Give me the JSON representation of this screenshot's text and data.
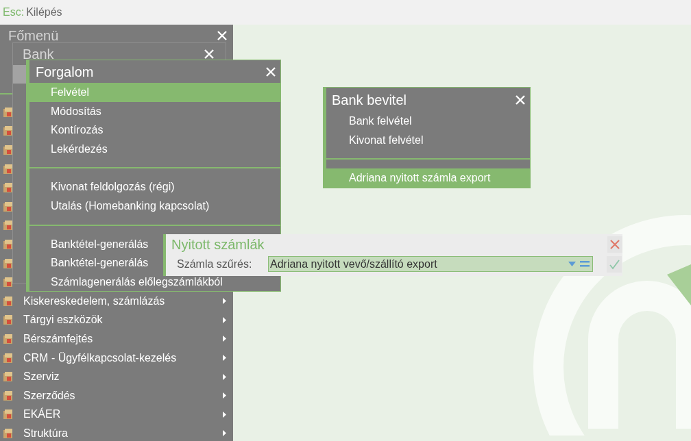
{
  "top_bar": {
    "key": "Esc:",
    "label": "Kilépés"
  },
  "main_menu": {
    "title": "Főmenü",
    "items": [
      {
        "kind": "icon-only"
      },
      {
        "kind": "icon-only"
      },
      {
        "kind": "icon-only"
      },
      {
        "kind": "icon-only"
      },
      {
        "kind": "icon-only"
      },
      {
        "kind": "icon-only"
      },
      {
        "kind": "icon-only"
      },
      {
        "kind": "icon-only"
      },
      {
        "kind": "icon-only"
      },
      {
        "kind": "icon-only"
      },
      {
        "kind": "entry",
        "label": "Kiskereskedelem, számlázás"
      },
      {
        "kind": "entry",
        "label": "Tárgyi eszközök"
      },
      {
        "kind": "entry",
        "label": "Bérszámfejtés"
      },
      {
        "kind": "entry",
        "label": "CRM - Ügyfélkapcsolat-kezelés"
      },
      {
        "kind": "entry",
        "label": "Szerviz"
      },
      {
        "kind": "entry",
        "label": "Szerződés"
      },
      {
        "kind": "entry",
        "label": "EKÁER"
      },
      {
        "kind": "entry",
        "label": "Struktúra"
      }
    ]
  },
  "bank_menu": {
    "title": "Bank"
  },
  "forgalom_menu": {
    "title": "Forgalom",
    "groups": [
      {
        "items": [
          {
            "label": "Felvétel",
            "selected": true
          },
          {
            "label": "Módosítás",
            "selected": false
          },
          {
            "label": "Kontírozás",
            "selected": false
          },
          {
            "label": "Lekérdezés",
            "selected": false
          }
        ]
      },
      {
        "items": [
          {
            "label": "Kivonat feldolgozás (régi)",
            "selected": false
          },
          {
            "label": "Utalás (Homebanking kapcsolat)",
            "selected": false
          }
        ]
      },
      {
        "items": [
          {
            "label": "Banktétel-generálás",
            "selected": false
          },
          {
            "label": "Banktétel-generálás",
            "selected": false
          },
          {
            "label": "Számlagenerálás előlegszámlákból",
            "selected": false
          }
        ]
      }
    ]
  },
  "bank_bevitel_menu": {
    "title": "Bank bevitel",
    "groups": [
      {
        "items": [
          {
            "label": "Bank felvétel",
            "selected": false
          },
          {
            "label": "Kivonat felvétel",
            "selected": false
          }
        ]
      },
      {
        "items": [
          {
            "label": "Adriana nyitott számla export",
            "selected": true
          }
        ]
      }
    ]
  },
  "nyitott_szamlak_dialog": {
    "title": "Nyitott számlák",
    "filter": {
      "label": "Számla szűrés:",
      "value": "Adriana nyitott vevő/szállító export"
    }
  }
}
